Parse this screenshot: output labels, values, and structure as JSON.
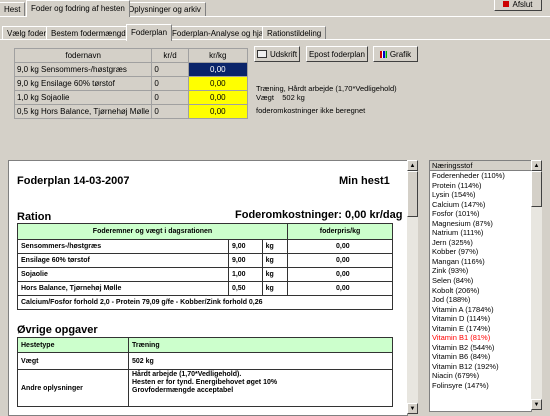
{
  "main_tabs": [
    "Hest",
    "Foder og fodring af hesten",
    "Oplysninger og arkiv"
  ],
  "sub_tabs": [
    "Vælg foder",
    "Bestem fodermængder",
    "Foderplan",
    "Foderplan-Analyse og hjælp",
    "Rationstildeling"
  ],
  "top_button": "Afslut",
  "feed_table": {
    "headers": [
      "fodernavn",
      "kr/d",
      "kr/kg"
    ],
    "rows": [
      {
        "name": "9,0 kg  Sensommers-/høstgræs",
        "krd": "0",
        "krkg": "0,00"
      },
      {
        "name": "9,0 kg  Ensilage 60% tørstof",
        "krd": "0",
        "krkg": "0,00"
      },
      {
        "name": "1,0 kg  Sojaolie",
        "krd": "0",
        "krkg": "0,00"
      },
      {
        "name": "0,5 kg  Hors Balance, Tjørnehøj Mølle",
        "krd": "0",
        "krkg": "0,00"
      }
    ]
  },
  "buttons": {
    "print": "Udskrift",
    "export": "Epost foderplan",
    "graph": "Grafik"
  },
  "info": {
    "line1": "Træning, Hårdt arbejde (1,70*Vedligehold)",
    "line2": "Vægt    502 kg",
    "line3": "foderomkostninger ikke beregnet"
  },
  "doc": {
    "title": "Foderplan 14-03-2007",
    "horse": "Min hest1",
    "ration_heading": "Ration",
    "cost_heading": "Foderomkostninger: 0,00 kr/dag",
    "ration_col1": "Foderemner og vægt i dagsrationen",
    "ration_col2": "foderpris/kg",
    "ration_rows": [
      {
        "name": "Sensommers-/høstgræs",
        "amount": "9,00",
        "unit": "kg",
        "price": "0,00"
      },
      {
        "name": "Ensilage 60% tørstof",
        "amount": "9,00",
        "unit": "kg",
        "price": "0,00"
      },
      {
        "name": "Sojaolie",
        "amount": "1,00",
        "unit": "kg",
        "price": "0,00"
      },
      {
        "name": "Hors Balance, Tjørnehøj Mølle",
        "amount": "0,50",
        "unit": "kg",
        "price": "0,00"
      }
    ],
    "ratio_line": "Calcium/Fosfor forhold 2,0 - Protein 79,09 g/fe - Kobber/Zink forhold 0,26",
    "other_heading": "Øvrige opgaver",
    "other_rows": [
      {
        "label": "Hestetype",
        "value": "Træning",
        "green": true
      },
      {
        "label": "Vægt",
        "value": "502 kg",
        "green": false
      },
      {
        "label": "Andre oplysninger",
        "value": "Hårdt arbejde (1,70*Vedligehold).\nHesten er for tynd. Energibehovet øget 10%\nGrovfodermængde acceptabel",
        "green": false
      }
    ]
  },
  "nutrients": {
    "header": "Næringsstof",
    "items": [
      {
        "label": "Foderenheder (110%)",
        "red": false
      },
      {
        "label": "Protein (114%)",
        "red": false
      },
      {
        "label": "Lysin (154%)",
        "red": false
      },
      {
        "label": "Calcium (147%)",
        "red": false
      },
      {
        "label": "Fosfor (101%)",
        "red": false
      },
      {
        "label": "Magnesium (87%)",
        "red": false
      },
      {
        "label": "Natrium (111%)",
        "red": false
      },
      {
        "label": "Jern (325%)",
        "red": false
      },
      {
        "label": "Kobber (97%)",
        "red": false
      },
      {
        "label": "Mangan (116%)",
        "red": false
      },
      {
        "label": "Zink (93%)",
        "red": false
      },
      {
        "label": "Selen (84%)",
        "red": false
      },
      {
        "label": "Kobolt (206%)",
        "red": false
      },
      {
        "label": "Jod (188%)",
        "red": false
      },
      {
        "label": "Vitamin A (1784%)",
        "red": false
      },
      {
        "label": "Vitamin D (114%)",
        "red": false
      },
      {
        "label": "Vitamin E (174%)",
        "red": false
      },
      {
        "label": "Vitamin B1 (81%)",
        "red": true
      },
      {
        "label": "Vitamin B2 (544%)",
        "red": false
      },
      {
        "label": "Vitamin B6 (84%)",
        "red": false
      },
      {
        "label": "Vitamin B12 (192%)",
        "red": false
      },
      {
        "label": "Niacin (679%)",
        "red": false
      },
      {
        "label": "Folinsyre (147%)",
        "red": false
      }
    ]
  },
  "colors": {
    "selected_cell": "#0a246a",
    "input_cell": "#ffff00",
    "header_green": "#ccffcc",
    "warning_red": "#ff0000"
  }
}
